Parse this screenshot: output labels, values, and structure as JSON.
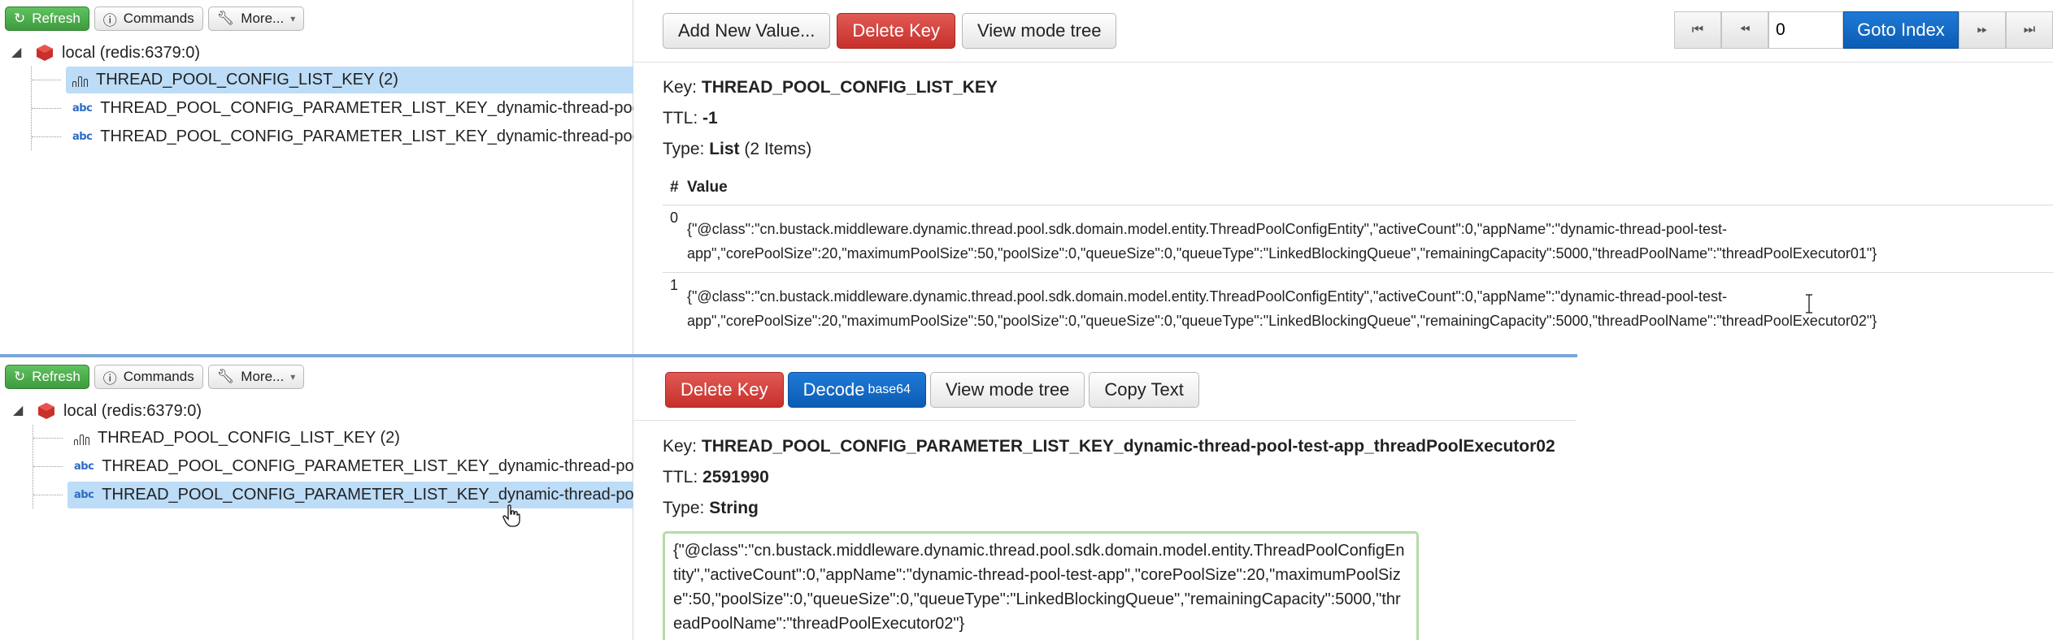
{
  "top": {
    "toolbar": {
      "refresh": "Refresh",
      "commands": "Commands",
      "more": "More..."
    },
    "tree": {
      "root": "local (redis:6379:0)",
      "items": [
        {
          "type": "list",
          "label": "THREAD_POOL_CONFIG_LIST_KEY (2)",
          "selected": true
        },
        {
          "type": "string",
          "label": "THREAD_POOL_CONFIG_PARAMETER_LIST_KEY_dynamic-thread-poo",
          "selected": false
        },
        {
          "type": "string",
          "label": "THREAD_POOL_CONFIG_PARAMETER_LIST_KEY_dynamic-thread-poo",
          "selected": false
        }
      ]
    },
    "actions": {
      "add": "Add New Value...",
      "delete": "Delete Key",
      "view_mode": "View mode tree"
    },
    "pager": {
      "index": "0",
      "goto": "Goto Index"
    },
    "key_label": "Key:",
    "key": "THREAD_POOL_CONFIG_LIST_KEY",
    "ttl_label": "TTL:",
    "ttl": "-1",
    "type_label": "Type:",
    "type": "List",
    "type_items": "(2 Items)",
    "table": {
      "headers": [
        "#",
        "Value"
      ],
      "rows": [
        {
          "index": "0",
          "value": "{\"@class\":\"cn.bustack.middleware.dynamic.thread.pool.sdk.domain.model.entity.ThreadPoolConfigEntity\",\"activeCount\":0,\"appName\":\"dynamic-thread-pool-test-app\",\"corePoolSize\":20,\"maximumPoolSize\":50,\"poolSize\":0,\"queueSize\":0,\"queueType\":\"LinkedBlockingQueue\",\"remainingCapacity\":5000,\"threadPoolName\":\"threadPoolExecutor01\"}"
        },
        {
          "index": "1",
          "value": "{\"@class\":\"cn.bustack.middleware.dynamic.thread.pool.sdk.domain.model.entity.ThreadPoolConfigEntity\",\"activeCount\":0,\"appName\":\"dynamic-thread-pool-test-app\",\"corePoolSize\":20,\"maximumPoolSize\":50,\"poolSize\":0,\"queueSize\":0,\"queueType\":\"LinkedBlockingQueue\",\"remainingCapacity\":5000,\"threadPoolName\":\"threadPoolExecutor02\"}"
        }
      ]
    }
  },
  "bottom": {
    "toolbar": {
      "refresh": "Refresh",
      "commands": "Commands",
      "more": "More..."
    },
    "tree": {
      "root": "local (redis:6379:0)",
      "items": [
        {
          "type": "list",
          "label": "THREAD_POOL_CONFIG_LIST_KEY (2)",
          "selected": false
        },
        {
          "type": "string",
          "label": "THREAD_POOL_CONFIG_PARAMETER_LIST_KEY_dynamic-thread-poo",
          "selected": false
        },
        {
          "type": "string",
          "label": "THREAD_POOL_CONFIG_PARAMETER_LIST_KEY_dynamic-thread-poo",
          "selected": true
        }
      ]
    },
    "actions": {
      "delete": "Delete Key",
      "decode": "Decode",
      "decode_sub": "base64",
      "view_mode": "View mode tree",
      "copy": "Copy Text"
    },
    "key_label": "Key:",
    "key": "THREAD_POOL_CONFIG_PARAMETER_LIST_KEY_dynamic-thread-pool-test-app_threadPoolExecutor02",
    "ttl_label": "TTL:",
    "ttl": "2591990",
    "type_label": "Type:",
    "type": "String",
    "value": "{\"@class\":\"cn.bustack.middleware.dynamic.thread.pool.sdk.domain.model.entity.ThreadPoolConfigEntity\",\"activeCount\":0,\"appName\":\"dynamic-thread-pool-test-app\",\"corePoolSize\":20,\"maximumPoolSize\":50,\"poolSize\":0,\"queueSize\":0,\"queueType\":\"LinkedBlockingQueue\",\"remainingCapacity\":5000,\"threadPoolName\":\"threadPoolExecutor02\"}"
  },
  "colors": {
    "green": "#4cae4c",
    "red": "#d2322d",
    "blue": "#0e62c0",
    "selection": "#bcdcf7",
    "value_border": "#b4dca8"
  }
}
